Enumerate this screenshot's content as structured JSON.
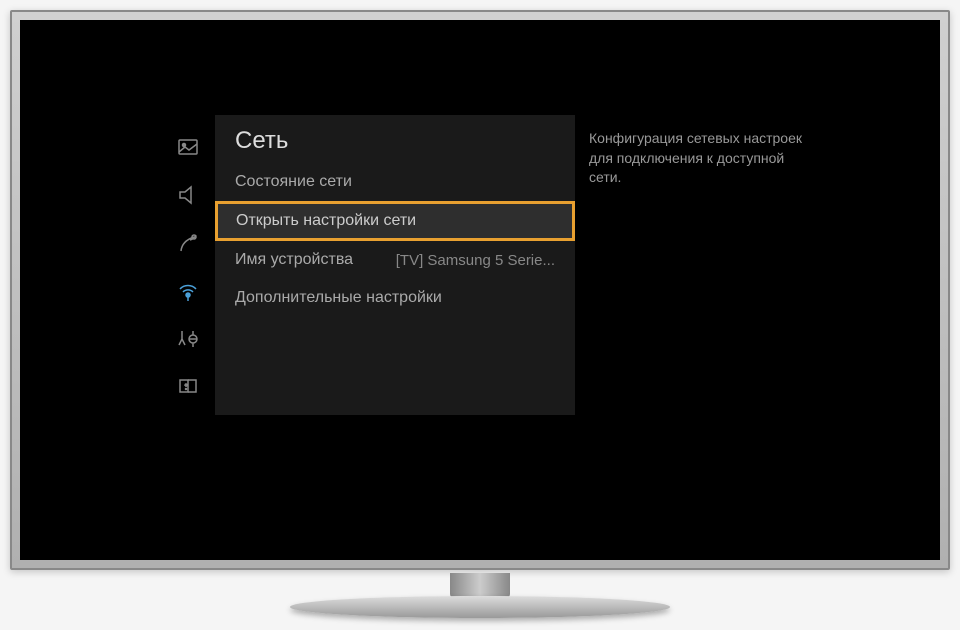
{
  "menu": {
    "title": "Сеть",
    "items": [
      {
        "label": "Состояние сети",
        "value": ""
      },
      {
        "label": "Открыть настройки сети",
        "value": ""
      },
      {
        "label": "Имя устройства",
        "value": "[TV] Samsung 5 Serie..."
      },
      {
        "label": "Дополнительные настройки",
        "value": ""
      }
    ]
  },
  "description": "Конфигурация сетевых настроек для подключения к доступной сети."
}
